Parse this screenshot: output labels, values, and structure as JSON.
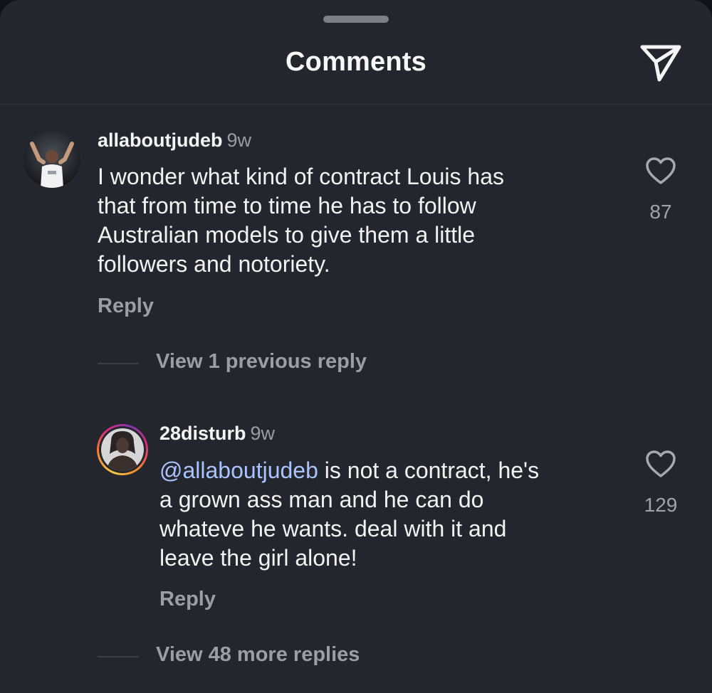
{
  "header": {
    "title": "Comments"
  },
  "comments": [
    {
      "username": "allaboutjudeb",
      "time": "9w",
      "lines": [
        "I wonder what kind of contract Louis has",
        "that from time to time he has to follow",
        "Australian models to give them a little",
        "followers and notoriety."
      ],
      "reply_label": "Reply",
      "like_count": "87",
      "view_replies_label": "View 1 previous reply"
    },
    {
      "username": "28disturb",
      "time": "9w",
      "mention": "@allaboutjudeb",
      "lines": [
        " is not a contract, he's",
        "a grown ass man and he can do",
        "whateve he wants. deal with it and",
        "leave the girl alone!"
      ],
      "reply_label": "Reply",
      "like_count": "129",
      "view_replies_label": "View 48 more replies"
    }
  ],
  "colors": {
    "background": "#24262d",
    "text": "#f2f2f4",
    "muted": "#9c9ea5",
    "mention": "#a9c4ff"
  },
  "icons": {
    "share": "paper-plane-icon",
    "like": "heart-outline-icon"
  }
}
